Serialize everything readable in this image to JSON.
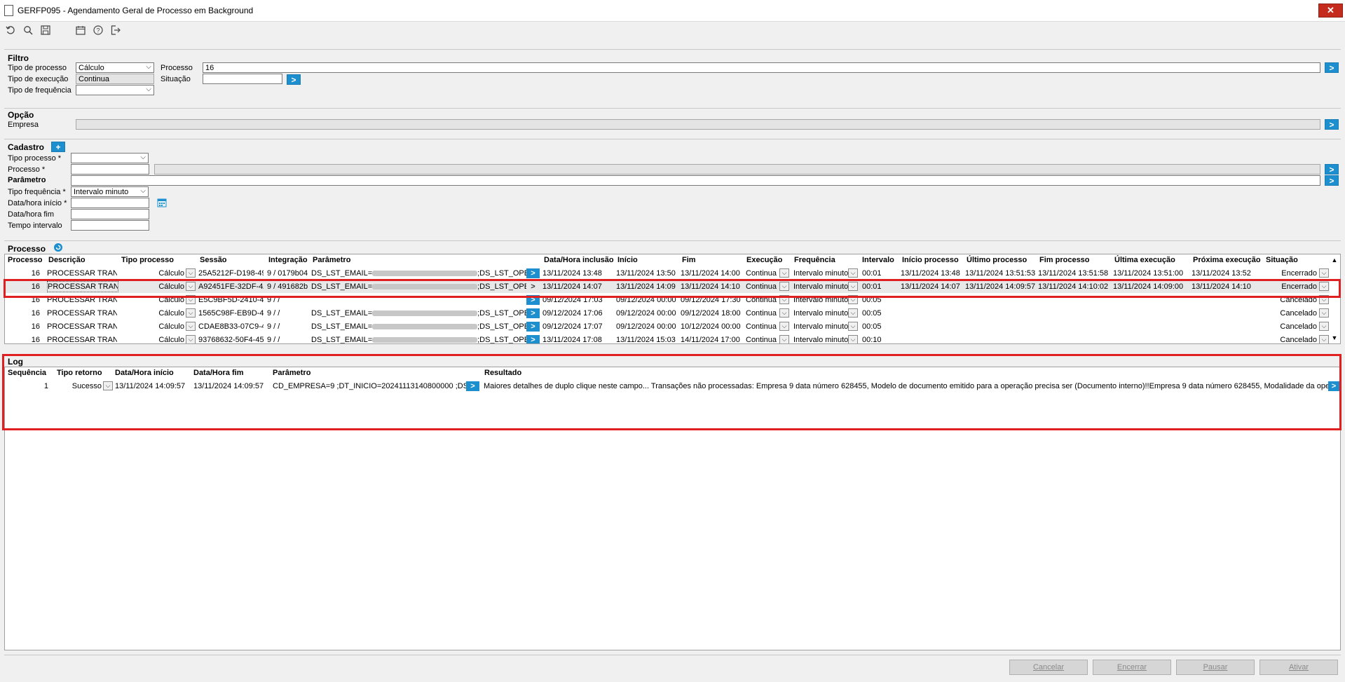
{
  "window": {
    "title": "GERFP095 - Agendamento Geral de Processo em Background",
    "close": "✕"
  },
  "toolbar": [
    "refresh-icon",
    "search-icon",
    "save-icon",
    "calendar-icon",
    "help-icon",
    "exit-icon"
  ],
  "filtro": {
    "title": "Filtro",
    "tipo_processo_label": "Tipo de processo",
    "tipo_processo_value": "Cálculo",
    "tipo_execucao_label": "Tipo de execução",
    "tipo_execucao_value": "Continua",
    "tipo_frequencia_label": "Tipo de frequência",
    "tipo_frequencia_value": "",
    "processo_label": "Processo",
    "processo_value": "16",
    "situacao_label": "Situação",
    "situacao_value": ""
  },
  "opcao": {
    "title": "Opção",
    "empresa_label": "Empresa"
  },
  "cadastro": {
    "title": "Cadastro",
    "tipo_processo_label": "Tipo processo *",
    "processo_label": "Processo *",
    "parametro_title": "Parâmetro",
    "tipo_frequencia_label": "Tipo frequência *",
    "tipo_frequencia_value": "Intervalo minuto",
    "data_inicio_label": "Data/hora início *",
    "data_fim_label": "Data/hora fim",
    "tempo_intervalo_label": "Tempo intervalo"
  },
  "processo_grid": {
    "title": "Processo",
    "columns": [
      "Processo",
      "Descrição",
      "Tipo processo",
      "Sessão",
      "Integração",
      "Parâmetro",
      "Data/Hora inclusão",
      "Início",
      "Fim",
      "Execução",
      "Frequência",
      "Intervalo",
      "Início processo",
      "Último processo",
      "Fim processo",
      "Última execução",
      "Próxima execução",
      "Situação"
    ],
    "rows": [
      {
        "processo": "16",
        "descricao": "PROCESSAR TRANS",
        "tipo": "Cálculo",
        "sessao": "25A5212F-D198-49",
        "integracao": "9 / 0179b04",
        "param_a": "DS_LST_EMAIL=",
        "param_b": ";DS_LST_OPER",
        "inclusao": "13/11/2024 13:48",
        "inicio": "13/11/2024 13:50",
        "fim": "13/11/2024 14:00",
        "execucao": "Continua",
        "frequencia": "Intervalo minuto",
        "intervalo": "00:01",
        "inicio_proc": "13/11/2024 13:48",
        "ultimo_proc": "13/11/2024 13:51:53",
        "fim_proc": "13/11/2024 13:51:58",
        "ultima_exec": "13/11/2024 13:51:00",
        "proxima_exec": "13/11/2024 13:52",
        "situacao": "Encerrado"
      },
      {
        "processo": "16",
        "descricao": "PROCESSAR TRANS",
        "tipo": "Cálculo",
        "sessao": "A92451FE-32DF-4A",
        "integracao": "9 / 491682b",
        "param_a": "DS_LST_EMAIL=",
        "param_b": ";DS_LST_OPER",
        "inclusao": "13/11/2024 14:07",
        "inicio": "13/11/2024 14:09",
        "fim": "13/11/2024 14:10",
        "execucao": "Continua",
        "frequencia": "Intervalo minuto",
        "intervalo": "00:01",
        "inicio_proc": "13/11/2024 14:07",
        "ultimo_proc": "13/11/2024 14:09:57",
        "fim_proc": "13/11/2024 14:10:02",
        "ultima_exec": "13/11/2024 14:09:00",
        "proxima_exec": "13/11/2024 14:10",
        "situacao": "Encerrado"
      },
      {
        "processo": "16",
        "descricao": "PROCESSAR TRANS",
        "tipo": "Cálculo",
        "sessao": "E5C9BF5D-2410-45",
        "integracao": "9 /  /",
        "param_a": "",
        "param_b": "",
        "inclusao": "09/12/2024 17:03",
        "inicio": "09/12/2024 00:00",
        "fim": "09/12/2024 17:30",
        "execucao": "Continua",
        "frequencia": "Intervalo minuto",
        "intervalo": "00:05",
        "inicio_proc": "",
        "ultimo_proc": "",
        "fim_proc": "",
        "ultima_exec": "",
        "proxima_exec": "",
        "situacao": "Cancelado"
      },
      {
        "processo": "16",
        "descricao": "PROCESSAR TRANS",
        "tipo": "Cálculo",
        "sessao": "1565C98F-EB9D-49",
        "integracao": "9 /  /",
        "param_a": "DS_LST_EMAIL=",
        "param_b": ";DS_LST_OPER",
        "inclusao": "09/12/2024 17:06",
        "inicio": "09/12/2024 00:00",
        "fim": "09/12/2024 18:00",
        "execucao": "Continua",
        "frequencia": "Intervalo minuto",
        "intervalo": "00:05",
        "inicio_proc": "",
        "ultimo_proc": "",
        "fim_proc": "",
        "ultima_exec": "",
        "proxima_exec": "",
        "situacao": "Cancelado"
      },
      {
        "processo": "16",
        "descricao": "PROCESSAR TRANS",
        "tipo": "Cálculo",
        "sessao": "CDAE8B33-07C9-46",
        "integracao": "9 /  /",
        "param_a": "DS_LST_EMAIL=",
        "param_b": ";DS_LST_OPER",
        "inclusao": "09/12/2024 17:07",
        "inicio": "09/12/2024 00:00",
        "fim": "10/12/2024 00:00",
        "execucao": "Continua",
        "frequencia": "Intervalo minuto",
        "intervalo": "00:05",
        "inicio_proc": "",
        "ultimo_proc": "",
        "fim_proc": "",
        "ultima_exec": "",
        "proxima_exec": "",
        "situacao": "Cancelado"
      },
      {
        "processo": "16",
        "descricao": "PROCESSAR TRANS",
        "tipo": "Cálculo",
        "sessao": "93768632-50F4-45",
        "integracao": "9 /  /",
        "param_a": "DS_LST_EMAIL=",
        "param_b": ";DS_LST_OPER",
        "inclusao": "13/11/2024 17:08",
        "inicio": "13/11/2024 15:03",
        "fim": "14/11/2024 17:00",
        "execucao": "Continua",
        "frequencia": "Intervalo minuto",
        "intervalo": "00:10",
        "inicio_proc": "",
        "ultimo_proc": "",
        "fim_proc": "",
        "ultima_exec": "",
        "proxima_exec": "",
        "situacao": "Cancelado"
      }
    ]
  },
  "log_grid": {
    "title": "Log",
    "columns": [
      "Sequência",
      "Tipo retorno",
      "Data/Hora início",
      "Data/Hora fim",
      "Parâmetro",
      "Resultado"
    ],
    "rows": [
      {
        "sequencia": "1",
        "tipo": "Sucesso",
        "inicio": "13/11/2024 14:09:57",
        "fim": "13/11/2024 14:09:57",
        "parametro": "CD_EMPRESA=9 ;DT_INICIO=20241113140800000 ;DS_LS",
        "resultado": "Maiores detalhes de duplo clique neste campo... Transações não processadas: Empresa 9 data  número 628455,  Modelo de documento emitido para a operação precisa ser (Documento interno)!!Empresa 9 data  número 628455,  Modalidade da opera"
      }
    ]
  },
  "footer": {
    "cancelar": "Cancelar",
    "encerrar": "Encerrar",
    "pausar": "Pausar",
    "ativar": "Ativar"
  },
  "colors": {
    "accent": "#1d8fcf",
    "highlight": "#e02020"
  }
}
